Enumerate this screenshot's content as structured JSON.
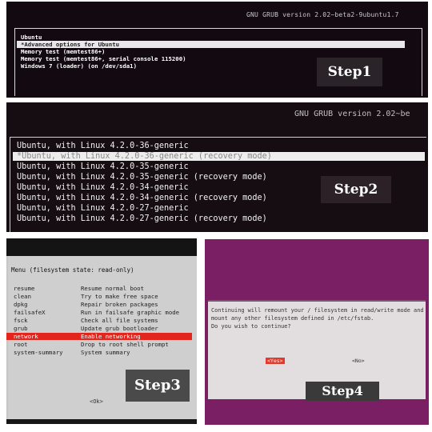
{
  "step1": {
    "header": "GNU GRUB  version 2.02~beta2-9ubuntu1.7",
    "entries": [
      "Ubuntu",
      "*Advanced options for Ubuntu",
      "Memory test (memtest86+)",
      "Memory test (memtest86+, serial console 115200)",
      "Windows 7 (loader) (on /dev/sda1)"
    ],
    "selected_index": 1,
    "label": "Step1"
  },
  "step2": {
    "header": "GNU GRUB  version 2.02~be",
    "entries": [
      "Ubuntu, with Linux 4.2.0-36-generic",
      "*Ubuntu, with Linux 4.2.0-36-generic (recovery mode)",
      "Ubuntu, with Linux 4.2.0-35-generic",
      "Ubuntu, with Linux 4.2.0-35-generic (recovery mode)",
      "Ubuntu, with Linux 4.2.0-34-generic",
      "Ubuntu, with Linux 4.2.0-34-generic (recovery mode)",
      "Ubuntu, with Linux 4.2.0-27-generic",
      "Ubuntu, with Linux 4.2.0-27-generic (recovery mode)"
    ],
    "selected_index": 1,
    "label": "Step2"
  },
  "step3": {
    "title": "Menu (filesystem state: read-only)",
    "items": [
      {
        "key": "resume",
        "desc": "Resume normal boot"
      },
      {
        "key": "clean",
        "desc": "Try to make free space"
      },
      {
        "key": "dpkg",
        "desc": "Repair broken packages"
      },
      {
        "key": "failsafeX",
        "desc": "Run in failsafe graphic mode"
      },
      {
        "key": "fsck",
        "desc": "Check all file systems"
      },
      {
        "key": "grub",
        "desc": "Update grub bootloader"
      },
      {
        "key": "network",
        "desc": "Enable networking"
      },
      {
        "key": "root",
        "desc": "Drop to root shell prompt"
      },
      {
        "key": "system-summary",
        "desc": "System summary"
      }
    ],
    "selected_index": 6,
    "ok_label": "<Ok>",
    "label": "Step3"
  },
  "step4": {
    "message_lines": [
      "Continuing will remount your / filesystem in read/write mode and",
      "mount any other filesystem defined in /etc/fstab.",
      "Do you wish to continue?"
    ],
    "yes_label": "<Yes>",
    "no_label": "<No>",
    "label": "Step4"
  },
  "colors": {
    "selection_red": "#e2261d",
    "purple_bg": "#7b1f64"
  }
}
